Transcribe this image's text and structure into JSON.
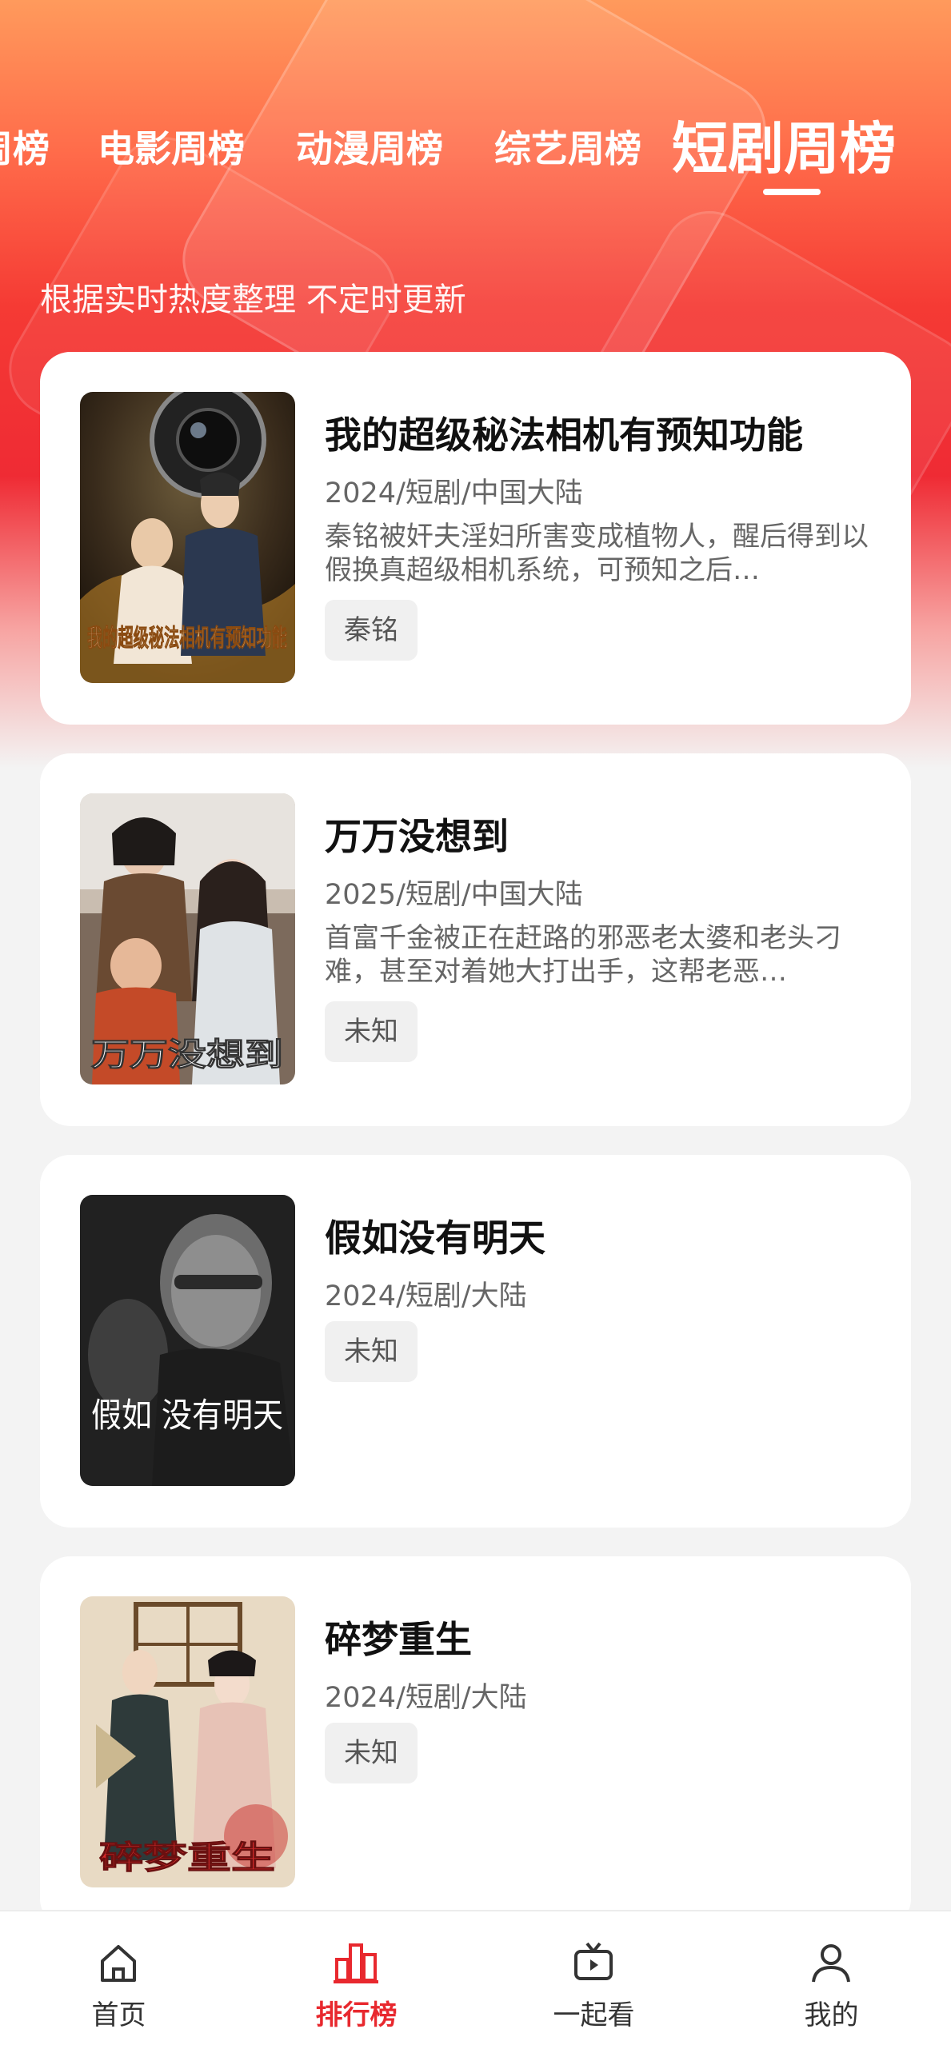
{
  "tabs": [
    {
      "label": "周榜"
    },
    {
      "label": "电影周榜"
    },
    {
      "label": "动漫周榜"
    },
    {
      "label": "综艺周榜"
    },
    {
      "label": "短剧周榜"
    }
  ],
  "active_tab": "短剧周榜",
  "subtitle": "根据实时热度整理 不定时更新",
  "items": [
    {
      "title": "我的超级秘法相机有预知功能",
      "meta": "2024/短剧/中国大陆",
      "description": "秦铭被奸夫淫妇所害变成植物人，醒后得到以假换真超级相机系统，可预知之后…",
      "tag": "秦铭",
      "poster_text": "我的超级秘法相机有预知功能"
    },
    {
      "title": "万万没想到",
      "meta": "2025/短剧/中国大陆",
      "description": "首富千金被正在赶路的邪恶老太婆和老头刁难，甚至对着她大打出手，这帮老恶…",
      "tag": "未知",
      "poster_text": "万万没想到"
    },
    {
      "title": "假如没有明天",
      "meta": "2024/短剧/大陆",
      "tag": "未知",
      "poster_text": "假如 没有明天"
    },
    {
      "title": "碎梦重生",
      "meta": "2024/短剧/大陆",
      "tag": "未知",
      "poster_text": "碎梦重生"
    }
  ],
  "nav": [
    {
      "label": "首页",
      "icon": "home-icon"
    },
    {
      "label": "排行榜",
      "icon": "ranking-icon"
    },
    {
      "label": "一起看",
      "icon": "tv-icon"
    },
    {
      "label": "我的",
      "icon": "user-icon"
    }
  ],
  "colors": {
    "accent": "#e8282e",
    "hero_top": "#ff9a5c",
    "hero_mid": "#ef2b34"
  }
}
